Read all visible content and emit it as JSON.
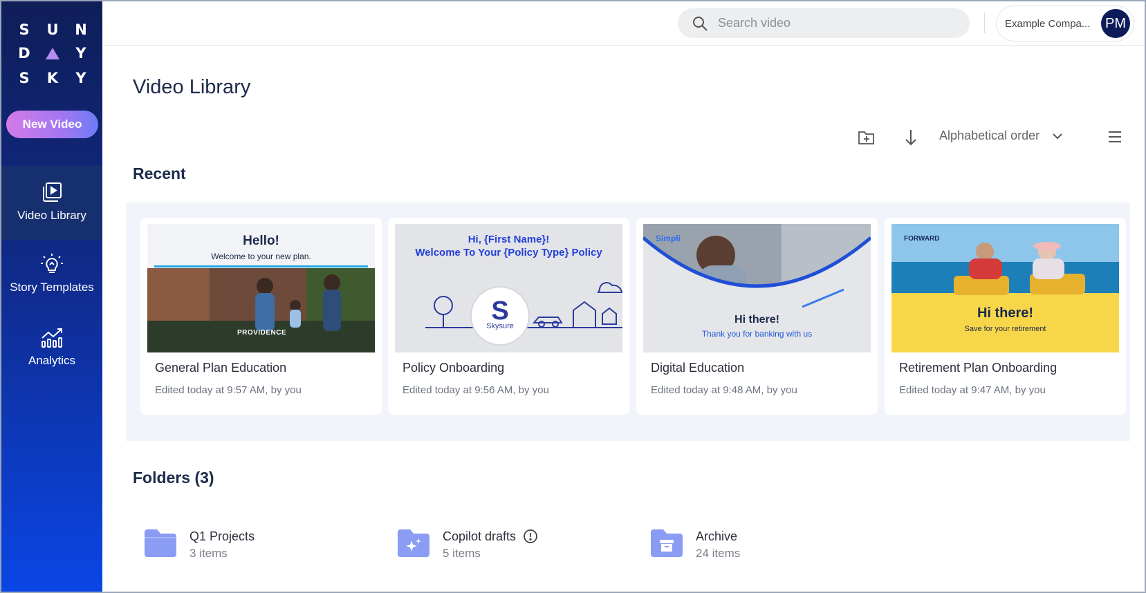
{
  "brand": {
    "logo_rows": [
      [
        "S",
        "U",
        "N"
      ],
      [
        "D",
        "",
        "Y"
      ],
      [
        "S",
        "K",
        "Y"
      ]
    ]
  },
  "sidebar": {
    "new_video_label": "New Video",
    "items": [
      {
        "label": "Video Library",
        "icon": "video-library-icon",
        "active": true
      },
      {
        "label": "Story Templates",
        "icon": "lightbulb-icon",
        "active": false
      },
      {
        "label": "Analytics",
        "icon": "analytics-icon",
        "active": false
      }
    ]
  },
  "header": {
    "search_placeholder": "Search video",
    "account_name": "Example Compa...",
    "avatar_initials": "PM"
  },
  "main": {
    "title": "Video Library",
    "sort_label": "Alphabetical order",
    "recent_title": "Recent",
    "recent": [
      {
        "title": "General Plan Education",
        "meta": "Edited today at 9:57 AM, by you",
        "thumb": {
          "heading": "Hello!",
          "sub": "Welcome to your new plan.",
          "brand": "PROVIDENCE"
        }
      },
      {
        "title": "Policy Onboarding",
        "meta": "Edited today at 9:56 AM, by you",
        "thumb": {
          "heading": "Hi, {First Name}!",
          "sub": "Welcome To Your {Policy Type} Policy",
          "brand": "Skysure"
        }
      },
      {
        "title": "Digital Education",
        "meta": "Edited today at 9:48 AM, by you",
        "thumb": {
          "heading": "Hi there!",
          "sub": "Thank you for banking with us",
          "brand": "Simpli"
        }
      },
      {
        "title": "Retirement Plan Onboarding",
        "meta": "Edited today at 9:47 AM, by you",
        "thumb": {
          "heading": "Hi there!",
          "sub": "Save for your retirement",
          "brand": "FORWARD"
        }
      }
    ],
    "folders_title": "Folders (3)",
    "folders": [
      {
        "name": "Q1 Projects",
        "count": "3 items",
        "icon": "folder-icon"
      },
      {
        "name": "Copilot drafts",
        "count": "5 items",
        "icon": "sparkle-folder-icon",
        "info": true
      },
      {
        "name": "Archive",
        "count": "24 items",
        "icon": "archive-folder-icon"
      }
    ]
  },
  "colors": {
    "sidebar_top": "#0f1e58",
    "sidebar_bottom": "#0a46e6",
    "accent_pink": "#d37be8",
    "folder_icon": "#8a9cf4",
    "title_text": "#1c2a4a"
  }
}
